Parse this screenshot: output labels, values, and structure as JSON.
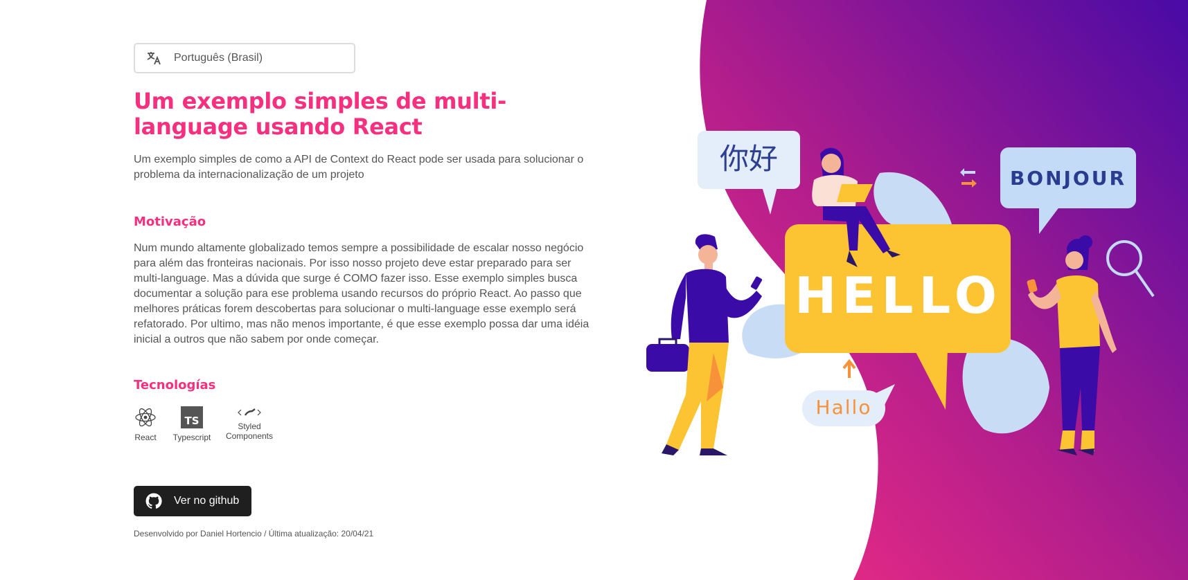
{
  "language_select": {
    "value": "Português (Brasil)",
    "icon": "translate-icon"
  },
  "title": "Um exemplo simples de multi-language usando React",
  "subtitle": "Um exemplo simples de como a API de Context do React pode ser usada para solucionar o problema da internacionalização de um projeto",
  "motivation": {
    "heading": "Motivação",
    "text": "Num mundo altamente globalizado temos sempre a possibilidade de escalar nosso negócio para além das fronteiras nacionais. Por isso nosso projeto deve estar preparado para ser multi-language. Mas a dúvida que surge é COMO fazer isso. Esse exemplo simples busca documentar a solução para ese problema usando recursos do próprio React. Ao passo que melhores práticas forem descobertas para solucionar o multi-language esse exemplo será refatorado. Por ultimo, mas não menos importante, é que esse exemplo possa dar uma idéia inicial a outros que não sabem por onde começar."
  },
  "technologies": {
    "heading": "Tecnologías",
    "items": [
      {
        "label": "React",
        "icon": "react-icon"
      },
      {
        "label": "Typescript",
        "icon": "typescript-icon"
      },
      {
        "label": "Styled Components",
        "icon": "styled-components-icon"
      }
    ]
  },
  "github_button": {
    "label": "Ver no github",
    "icon": "github-icon"
  },
  "footer": "Desenvolvido por Daniel Hortencio / Última atualização: 20/04/21",
  "illustration": {
    "greetings": {
      "chinese": "你好",
      "english": "HELLO",
      "french": "BONJOUR",
      "german": "Hallo"
    },
    "colors": {
      "accent": "#f5317f",
      "purple": "#4a0aa6",
      "yellow": "#fcc332",
      "bubble_light": "#e3eefa",
      "bubble_blue": "#c3dbf7",
      "navy": "#2d1b9e"
    }
  }
}
